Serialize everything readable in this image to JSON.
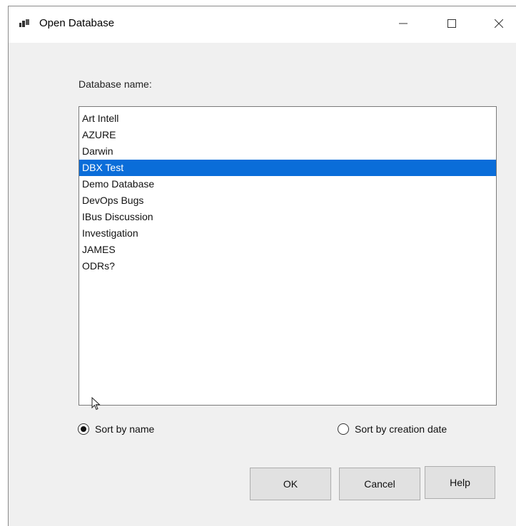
{
  "window": {
    "title": "Open Database",
    "icons": {
      "app": "database-window-icon",
      "minimize": "minimize-icon",
      "maximize": "maximize-icon",
      "close": "close-icon"
    }
  },
  "dialog": {
    "list_label": "Database name:",
    "databases": [
      "Art Intell",
      "AZURE",
      "Darwin",
      "DBX Test",
      "Demo Database",
      "DevOps Bugs",
      "IBus Discussion",
      "Investigation",
      "JAMES",
      "ODRs?"
    ],
    "selected": "DBX Test",
    "sort_options": {
      "by_name": "Sort by name",
      "by_date": "Sort by creation date",
      "checked": "by_name"
    },
    "buttons": {
      "ok": "OK",
      "cancel": "Cancel",
      "help": "Help"
    }
  },
  "colors": {
    "selection": "#0a6dd9",
    "dialog_bg": "#f0f0f0",
    "button_bg": "#e1e1e1"
  }
}
